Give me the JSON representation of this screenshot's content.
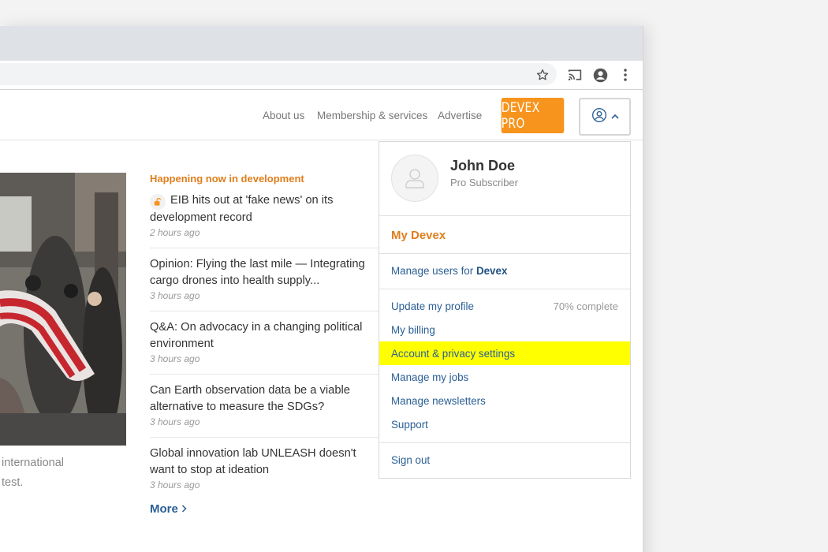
{
  "browser": {
    "icons": [
      "star-icon",
      "cast-icon",
      "account-circle-icon",
      "more-vert-icon"
    ]
  },
  "header": {
    "nav": [
      "About us",
      "Membership & services",
      "Advertise"
    ],
    "pro_button": "DEVEX PRO",
    "user_button_icons": [
      "user-circle-icon",
      "chevron-up-icon"
    ]
  },
  "hero": {
    "excerpt_lines": [
      "international",
      "test."
    ]
  },
  "news": {
    "heading": "Happening now in development",
    "items": [
      {
        "title": "EIB hits out at 'fake news' on its development record",
        "time": "2 hours ago",
        "locked": true
      },
      {
        "title": "Opinion: Flying the last mile — Integrating cargo drones into health supply...",
        "time": "3 hours ago"
      },
      {
        "title": "Q&A: On advocacy in a changing political environment",
        "time": "3 hours ago"
      },
      {
        "title": "Can Earth observation data be a viable alternative to measure the SDGs?",
        "time": "3 hours ago"
      },
      {
        "title": "Global innovation lab UNLEASH doesn't want to stop at ideation",
        "time": "3 hours ago"
      }
    ],
    "more": "More"
  },
  "dropdown": {
    "name": "John Doe",
    "subscription": "Pro Subscriber",
    "my_devex": "My Devex",
    "manage_users_prefix": "Manage users for ",
    "manage_users_org": "Devex",
    "profile": "Update my profile",
    "profile_progress": "70% complete",
    "billing": "My billing",
    "account_privacy": "Account & privacy settings",
    "jobs": "Manage my jobs",
    "newsletters": "Manage newsletters",
    "support": "Support",
    "sign_out": "Sign out"
  },
  "colors": {
    "accent_orange": "#f7941d",
    "link_blue": "#2b5f95",
    "highlight": "#ffff00"
  }
}
